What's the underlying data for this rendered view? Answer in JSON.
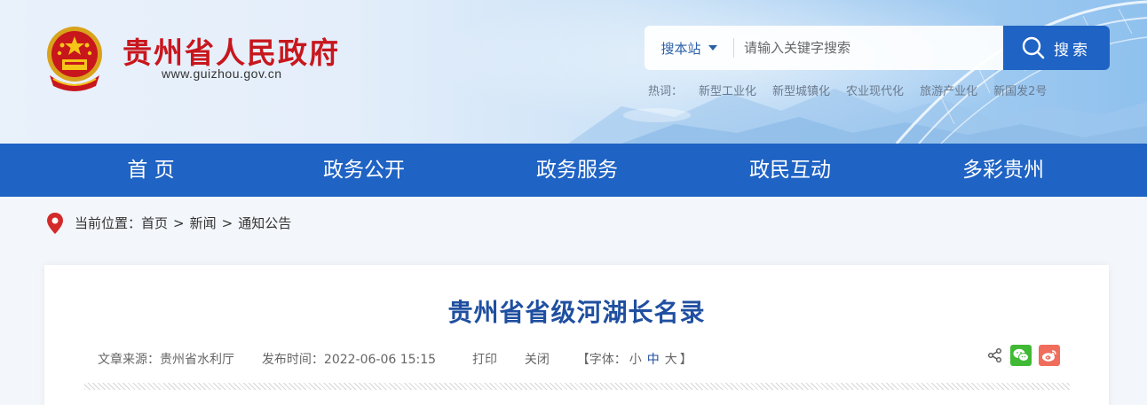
{
  "header": {
    "site_title": "贵州省人民政府",
    "site_url": "www.guizhou.gov.cn",
    "search": {
      "scope_label": "搜本站",
      "placeholder": "请输入关键字搜索",
      "button_label": "搜索"
    },
    "hot": {
      "label": "热词：",
      "words": [
        "新型工业化",
        "新型城镇化",
        "农业现代化",
        "旅游产业化",
        "新国发2号"
      ]
    }
  },
  "nav": {
    "items": [
      {
        "label": "首 页"
      },
      {
        "label": "政务公开"
      },
      {
        "label": "政务服务"
      },
      {
        "label": "政民互动"
      },
      {
        "label": "多彩贵州"
      }
    ]
  },
  "breadcrumb": {
    "prefix": "当前位置：",
    "items": [
      "首页",
      "新闻",
      "通知公告"
    ],
    "separator": ">"
  },
  "article": {
    "title": "贵州省省级河湖长名录",
    "source_label": "文章来源：",
    "source": "贵州省水利厅",
    "time_label": "发布时间：",
    "time": "2022-06-06 15:15",
    "print_label": "打印",
    "close_label": "关闭",
    "font_label_open": "【字体：",
    "font_small": "小",
    "font_medium": "中",
    "font_large": "大",
    "font_label_close": "】"
  },
  "colors": {
    "brand_blue": "#1f63c4",
    "title_red": "#c8161d",
    "article_title": "#1f4fa0",
    "wechat": "#40b934",
    "weibo": "#f06d5c"
  },
  "icons": {
    "search": "magnifier-icon",
    "location": "map-pin-icon",
    "share": "share-icon",
    "wechat": "wechat-icon",
    "weibo": "weibo-icon"
  }
}
